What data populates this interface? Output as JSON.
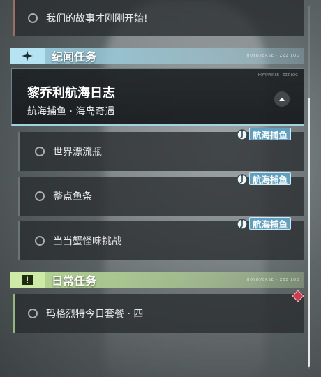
{
  "top_item": {
    "label": "我们的故事才刚刚开始!"
  },
  "sections": {
    "chronicle": {
      "title": "纪闻任务",
      "deco_text": "HOYOVERSE · ZZZ LOG",
      "header_color": "#9fd6e8",
      "main_quest": {
        "title": "黎乔利航海日志",
        "subtitle": "航海捕鱼 · 海岛奇遇"
      },
      "sub_quests": [
        {
          "label": "世界漂流瓶",
          "tag": "航海捕鱼"
        },
        {
          "label": "整点鱼条",
          "tag": "航海捕鱼"
        },
        {
          "label": "当当蟹怪味挑战",
          "tag": "航海捕鱼"
        }
      ]
    },
    "daily": {
      "title": "日常任务",
      "deco_text": "HOYOVERSE · ZZZ LOG",
      "header_color": "#bfe39a",
      "items": [
        {
          "label": "玛格烈特今日套餐 · 四"
        }
      ]
    }
  },
  "icons": {
    "chronicle": "sparkle-icon",
    "daily": "exclamation-box-icon",
    "tag": "fishing-hook-icon",
    "collapse": "chevron-up-icon",
    "marker": "red-diamond-icon"
  },
  "colors": {
    "tag_bg": "#5f9fc0",
    "marker": "#d23a4e"
  }
}
